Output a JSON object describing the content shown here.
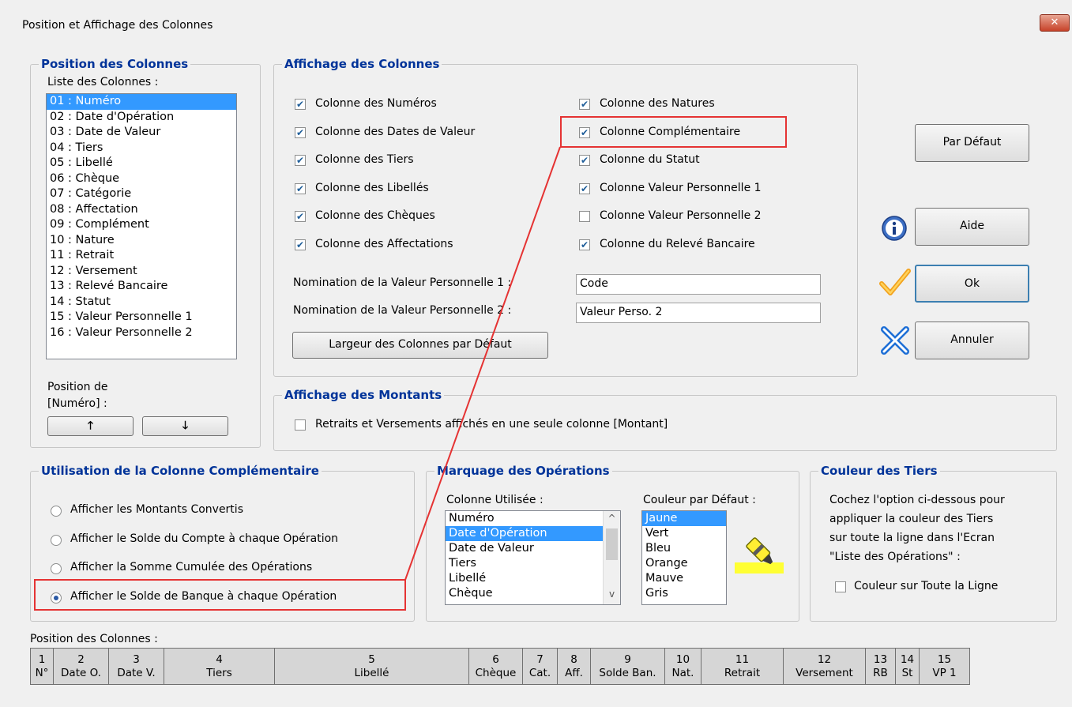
{
  "window": {
    "title": "Position et Affichage des Colonnes",
    "close_glyph": "✕"
  },
  "position_group": {
    "legend": "Position des Colonnes",
    "list_label": "Liste des Colonnes :",
    "items": [
      "01 : Numéro",
      "02 : Date d'Opération",
      "03 : Date de Valeur",
      "04 : Tiers",
      "05 : Libellé",
      "06 : Chèque",
      "07 : Catégorie",
      "08 : Affectation",
      "09 : Complément",
      "10 : Nature",
      "11 : Retrait",
      "12 : Versement",
      "13 : Relevé Bancaire",
      "14 : Statut",
      "15 : Valeur Personnelle 1",
      "16 : Valeur Personnelle 2"
    ],
    "selected_index": 0,
    "position_label_line1": "Position de",
    "position_label_line2": "[Numéro] :",
    "up_glyph": "🡑",
    "down_glyph": "🡓"
  },
  "affichage_group": {
    "legend": "Affichage des Colonnes",
    "checkboxes_left": [
      {
        "label": "Colonne des Numéros",
        "checked": true
      },
      {
        "label": "Colonne des Dates de Valeur",
        "checked": true
      },
      {
        "label": "Colonne des Tiers",
        "checked": true
      },
      {
        "label": "Colonne des Libellés",
        "checked": true
      },
      {
        "label": "Colonne des Chèques",
        "checked": true
      },
      {
        "label": "Colonne des Affectations",
        "checked": true
      }
    ],
    "checkboxes_right": [
      {
        "label": "Colonne des Natures",
        "checked": true
      },
      {
        "label": "Colonne Complémentaire",
        "checked": true
      },
      {
        "label": "Colonne du Statut",
        "checked": true
      },
      {
        "label": "Colonne Valeur Personnelle 1",
        "checked": true
      },
      {
        "label": "Colonne Valeur Personnelle 2",
        "checked": false
      },
      {
        "label": "Colonne du Relevé Bancaire",
        "checked": true
      }
    ],
    "vp1_label": "Nomination de la Valeur Personnelle 1 :",
    "vp1_value": "Code",
    "vp2_label": "Nomination de la Valeur Personnelle 2 :",
    "vp2_value": "Valeur Perso. 2",
    "default_width_button": "Largeur des Colonnes par Défaut"
  },
  "montants_group": {
    "legend": "Affichage des Montants",
    "checkbox_label": "Retraits et Versements affichés en une seule colonne [Montant]",
    "checked": false
  },
  "buttons": {
    "par_defaut": "Par Défaut",
    "aide": "Aide",
    "ok": "Ok",
    "annuler": "Annuler",
    "info_icon": "info-icon",
    "check_icon": "checkmark-icon",
    "cross_icon": "cross-icon"
  },
  "complementaire_group": {
    "legend": "Utilisation de la Colonne Complémentaire",
    "options": [
      "Afficher les Montants Convertis",
      "Afficher le Solde du Compte à chaque Opération",
      "Afficher la Somme Cumulée des Opérations",
      "Afficher le Solde de Banque à chaque Opération"
    ],
    "selected_index": 3
  },
  "marquage_group": {
    "legend": "Marquage des Opérations",
    "col_label": "Colonne Utilisée :",
    "col_items": [
      "Numéro",
      "Date d'Opération",
      "Date de Valeur",
      "Tiers",
      "Libellé",
      "Chèque"
    ],
    "col_selected": 1,
    "color_label": "Couleur par Défaut :",
    "color_items": [
      "Jaune",
      "Vert",
      "Bleu",
      "Orange",
      "Mauve",
      "Gris"
    ],
    "color_selected": 0,
    "highlighter_icon": "highlighter-icon"
  },
  "tiers_group": {
    "legend": "Couleur des Tiers",
    "description_lines": [
      "Cochez l'option ci-dessous pour",
      "appliquer la couleur des Tiers",
      "sur toute la ligne dans l'Ecran",
      "\"Liste des Opérations\" :"
    ],
    "checkbox_label": "Couleur sur Toute la Ligne",
    "checked": false
  },
  "header_preview": {
    "label": "Position des Colonnes :",
    "columns": [
      {
        "num": "1",
        "name": "N°"
      },
      {
        "num": "2",
        "name": "Date O."
      },
      {
        "num": "3",
        "name": "Date V."
      },
      {
        "num": "4",
        "name": "Tiers"
      },
      {
        "num": "5",
        "name": "Libellé"
      },
      {
        "num": "6",
        "name": "Chèque"
      },
      {
        "num": "7",
        "name": "Cat."
      },
      {
        "num": "8",
        "name": "Aff."
      },
      {
        "num": "9",
        "name": "Solde Ban."
      },
      {
        "num": "10",
        "name": "Nat."
      },
      {
        "num": "11",
        "name": "Retrait"
      },
      {
        "num": "12",
        "name": "Versement"
      },
      {
        "num": "13",
        "name": "RB"
      },
      {
        "num": "14",
        "name": "St"
      },
      {
        "num": "15",
        "name": "VP 1"
      }
    ]
  },
  "colors": {
    "accent": "#003399",
    "selection": "#3399ff",
    "annotation": "#e53333"
  }
}
